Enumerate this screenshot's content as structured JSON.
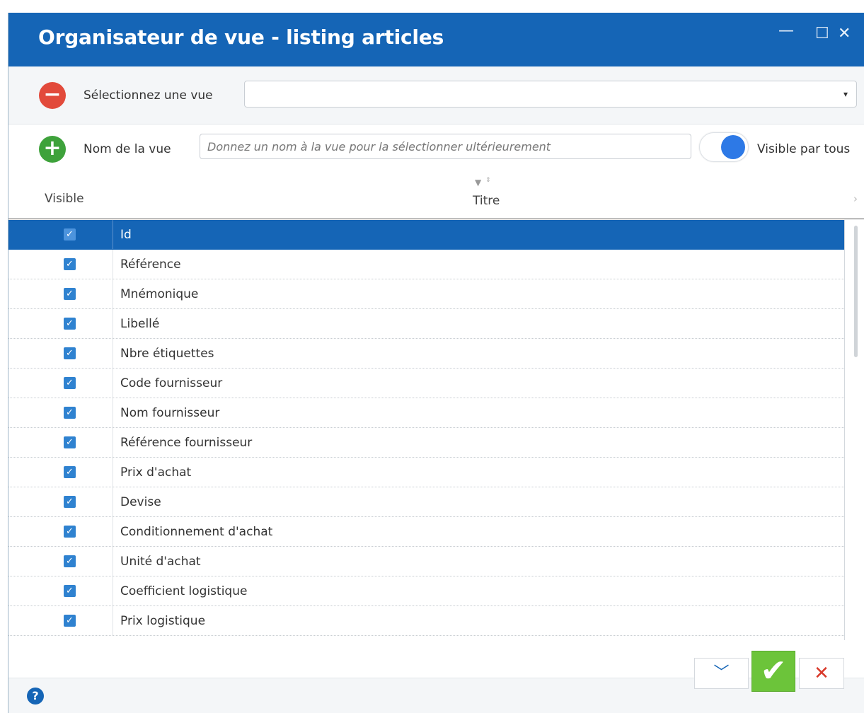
{
  "window": {
    "title": "Organisateur de vue - listing articles",
    "controls": {
      "minimize": "—",
      "maximize": "☐",
      "close": "✕"
    }
  },
  "view_select": {
    "remove_icon": "−",
    "label": "Sélectionnez une vue",
    "value": "",
    "arrow": "▾"
  },
  "view_name": {
    "add_icon": "+",
    "label": "Nom de la vue",
    "value": "",
    "placeholder": "Donnez un nom à la vue pour la sélectionner ultérieurement",
    "toggle_on": true,
    "toggle_label": "Visible par tous"
  },
  "columns": {
    "visible": "Visible",
    "titre": "Titre",
    "filter_icon": "▼",
    "sort_icon": "⇕",
    "next_icon": "›"
  },
  "rows": [
    {
      "title": "Id",
      "visible": true,
      "selected": true
    },
    {
      "title": "Référence",
      "visible": true
    },
    {
      "title": "Mnémonique",
      "visible": true
    },
    {
      "title": "Libellé",
      "visible": true
    },
    {
      "title": "Nbre étiquettes",
      "visible": true
    },
    {
      "title": "Code fournisseur",
      "visible": true
    },
    {
      "title": "Nom fournisseur",
      "visible": true
    },
    {
      "title": "Référence fournisseur",
      "visible": true
    },
    {
      "title": "Prix d'achat",
      "visible": true
    },
    {
      "title": "Devise",
      "visible": true
    },
    {
      "title": "Conditionnement d'achat",
      "visible": true
    },
    {
      "title": "Unité d'achat",
      "visible": true
    },
    {
      "title": "Coefficient logistique",
      "visible": true
    },
    {
      "title": "Prix logistique",
      "visible": true
    }
  ],
  "footer": {
    "help_icon": "?",
    "collapse_icon": "﹀",
    "validate_icon": "✔",
    "cancel_icon": "✕"
  },
  "colors": {
    "titlebar": "#1565b6",
    "selected_row": "#1565b6",
    "remove": "#e24a3b",
    "add": "#3ea23b",
    "validate": "#6cc43a",
    "cancel": "#d93a2b"
  }
}
